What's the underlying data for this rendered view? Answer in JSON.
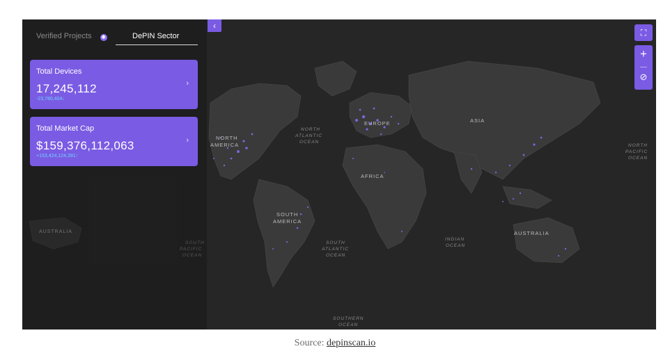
{
  "tabs": {
    "verified_label": "Verified Projects",
    "verified_badge": "✱",
    "depin_label": "DePIN Sector"
  },
  "cards": {
    "devices": {
      "title": "Total Devices",
      "value": "17,245,112",
      "delta": "-23,780,404↓"
    },
    "market_cap": {
      "title": "Total Market Cap",
      "value": "$159,376,112,063",
      "delta": "+153,424,124,391↑"
    }
  },
  "controls": {
    "collapse": "‹",
    "fullscreen": "⛶",
    "zoom_in": "+",
    "compass": "⊘"
  },
  "map_labels": {
    "north_america": [
      "NORTH",
      "AMERICA"
    ],
    "south_america": [
      "SOUTH",
      "AMERICA"
    ],
    "europe": "EUROPE",
    "asia": "ASIA",
    "africa": "AFRICA",
    "australia": "AUSTRALIA",
    "australia_left": "AUSTRALIA",
    "north_atlantic": [
      "NORTH",
      "ATLANTIC",
      "OCEAN"
    ],
    "south_atlantic": [
      "SOUTH",
      "ATLANTIC",
      "OCEAN"
    ],
    "indian_ocean": [
      "INDIAN",
      "OCEAN"
    ],
    "north_pacific": [
      "NORTH",
      "PACIFIC",
      "OCEAN"
    ],
    "south_pacific": [
      "SOUTH",
      "PACIFIC",
      "OCEAN"
    ],
    "southern_ocean": [
      "SOUTHERN",
      "OCEAN"
    ]
  },
  "source": {
    "prefix": "Source: ",
    "link": "depinscan.io"
  },
  "colors": {
    "accent": "#7a5be3",
    "map_bg": "#262626",
    "land": "#3a3a3a",
    "device_dot": "#8b6cf6"
  }
}
